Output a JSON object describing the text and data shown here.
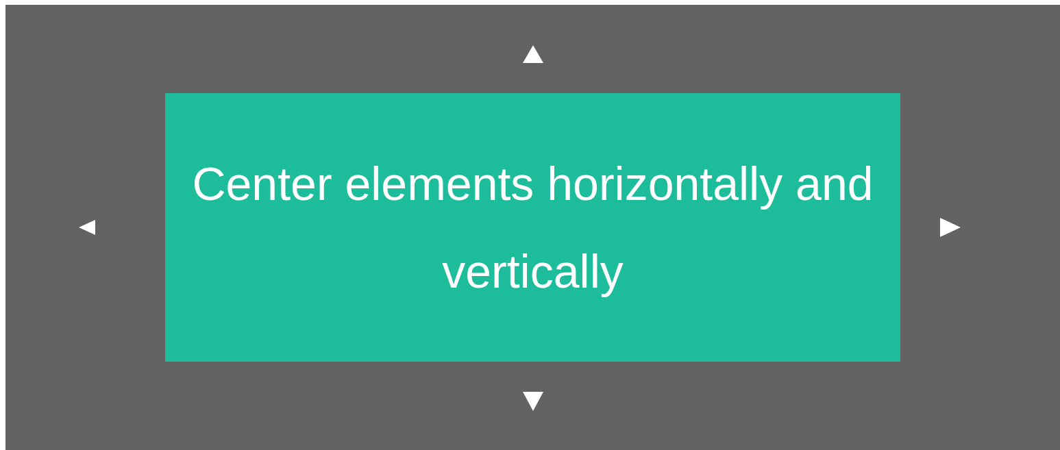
{
  "box": {
    "text": "Center elements horizontally and vertically"
  }
}
